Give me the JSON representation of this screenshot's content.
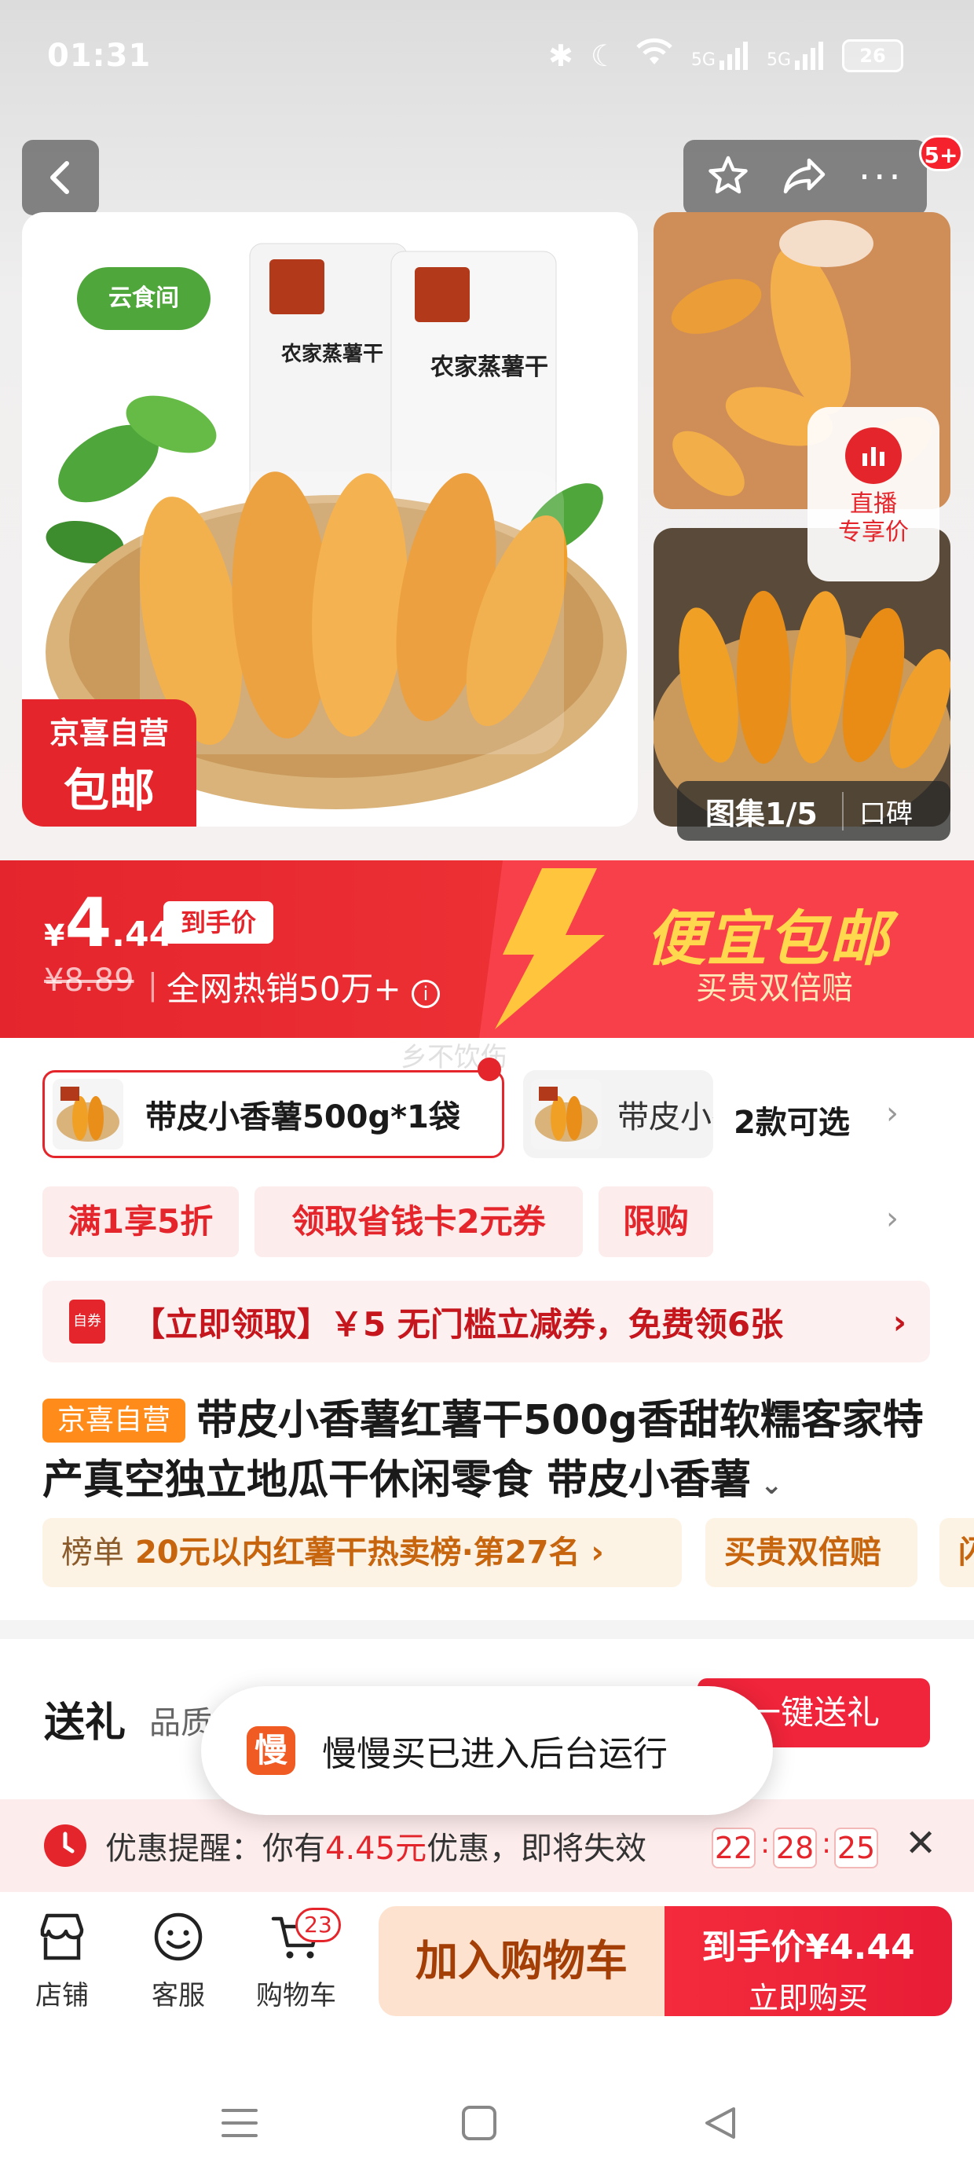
{
  "status_bar": {
    "time": "01:31",
    "network_1": "5G",
    "network_2": "5G",
    "battery": "26"
  },
  "header": {
    "cart_badge": "5+"
  },
  "gallery": {
    "promo_line1": "京喜自营",
    "promo_line2": "包邮",
    "live_label_1": "直播",
    "live_label_2": "专享价",
    "counter": "图集1/5",
    "reviews_label": "口碑",
    "package_brand": "云食间",
    "package_label": "农家蒸薯干"
  },
  "price_banner": {
    "currency": "¥",
    "price_int": "4",
    "price_dec": ".44",
    "price_tag": "到手价",
    "original_price": "¥8.89",
    "separator": "|",
    "sales": "全网热销50万+",
    "slogan": "便宜包邮",
    "subslogan": "买贵双倍赔"
  },
  "variants": {
    "watermark": "乡不饮伤",
    "selected": "带皮小香薯500g*1袋",
    "other": "带皮小香薯",
    "count": "2款可选"
  },
  "coupons": [
    "满1享5折",
    "领取省钱卡2元券",
    "限购"
  ],
  "voucher": {
    "icon_text": "自券",
    "text": "【立即领取】￥5 无门槛立减券，免费领6张"
  },
  "product": {
    "self_tag": "京喜自营",
    "title": "带皮小香薯红薯干500g香甜软糯客家特产真空独立地瓜干休闲零食 带皮小香薯"
  },
  "ranks": {
    "rank_label": "榜单",
    "rank_text": "20元以内红薯干热卖榜·第27名",
    "guarantee": "买贵双倍赔",
    "partial": "闪"
  },
  "gift": {
    "label": "送礼",
    "sub": "品质",
    "button": "一键送礼"
  },
  "toast": {
    "icon": "慢",
    "text": "慢慢买已进入后台运行"
  },
  "reminder": {
    "prefix": "优惠提醒：你有",
    "amount": "4.45元",
    "suffix": "优惠，即将失效",
    "countdown": [
      "22",
      "28",
      "25"
    ],
    "sep": ":"
  },
  "bottom_bar": {
    "shop": "店铺",
    "service": "客服",
    "cart": "购物车",
    "cart_count": "23",
    "add_to_cart": "加入购物车",
    "buy_price": "到手价¥4.44",
    "buy_now": "立即购买"
  },
  "colors": {
    "brand_red": "#e4262c",
    "gold": "#ffd84d",
    "orange_tag": "#ff8c1a"
  }
}
